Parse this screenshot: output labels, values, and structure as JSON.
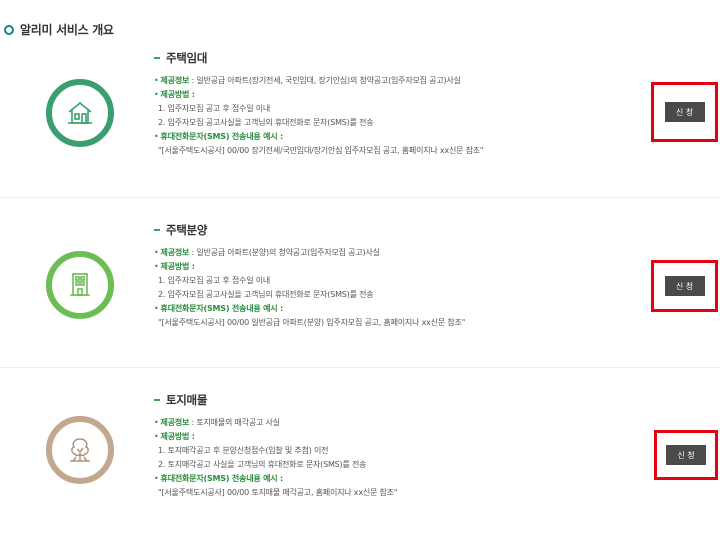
{
  "page": {
    "heading": "알리미 서비스 개요"
  },
  "colors": {
    "rental": "#3a9e6e",
    "sale": "#6dbd55",
    "land": "#c2a88e",
    "highlight": "#e60012",
    "button": "#4a4a4a",
    "accent": "#2a8c3e"
  },
  "services": [
    {
      "title": "주택임대",
      "icon": "house-icon",
      "info_key": "제공정보",
      "info_value": " : 일반공급 아파트(장기전세, 국민임대, 장기안심)의 청약공고(입주자모집 공고)사실",
      "method_key": "제공방법",
      "method_suffix": " :",
      "steps": [
        "1. 입주자모집 공고 후 접수일 이내",
        "2. 입주자모집 공고사실을 고객님의 휴대전화로 문자(SMS)를 전송"
      ],
      "sms_key": "휴대전화문자(SMS) 전송내용 예시",
      "sms_suffix": " :",
      "sms_example": "\"[서울주택도시공사] 00/00 장기전세/국민임대/장기안심 입주자모집 공고, 홈페이지나 xx신문 참조\"",
      "apply_label": "신 청"
    },
    {
      "title": "주택분양",
      "icon": "apartment-building-icon",
      "info_key": "제공정보",
      "info_value": " : 일반공급 아파트(분양)의 청약공고(입주자모집 공고)사실",
      "method_key": "제공방법",
      "method_suffix": " :",
      "steps": [
        "1. 입주자모집 공고 후 접수일 이내",
        "2. 입주자모집 공고사실을 고객님의 휴대전화로 문자(SMS)를 전송"
      ],
      "sms_key": "휴대전화문자(SMS) 전송내용 예시",
      "sms_suffix": " :",
      "sms_example": "\"[서울주택도시공사] 00/00 일반공급 아파트(분양) 입주자모집 공고, 홈페이지나 xx신문 참조\"",
      "apply_label": "신 청"
    },
    {
      "title": "토지매물",
      "icon": "land-tree-icon",
      "info_key": "제공정보",
      "info_value": " : 토지매물의 매각공고 사실",
      "method_key": "제공방법",
      "method_suffix": " :",
      "steps": [
        "1. 토지매각공고 후 분양신청접수(입찰 및 추첨) 이전",
        "2. 토지매각공고 사실을 고객님의 휴대전화로 문자(SMS)를 전송"
      ],
      "sms_key": "휴대전화문자(SMS) 전송내용 예시",
      "sms_suffix": " :",
      "sms_example": "\"[서울주택도시공사] 00/00 토지매물 매각공고, 홈페이지나 xx신문 참조\"",
      "apply_label": "신 청"
    }
  ]
}
